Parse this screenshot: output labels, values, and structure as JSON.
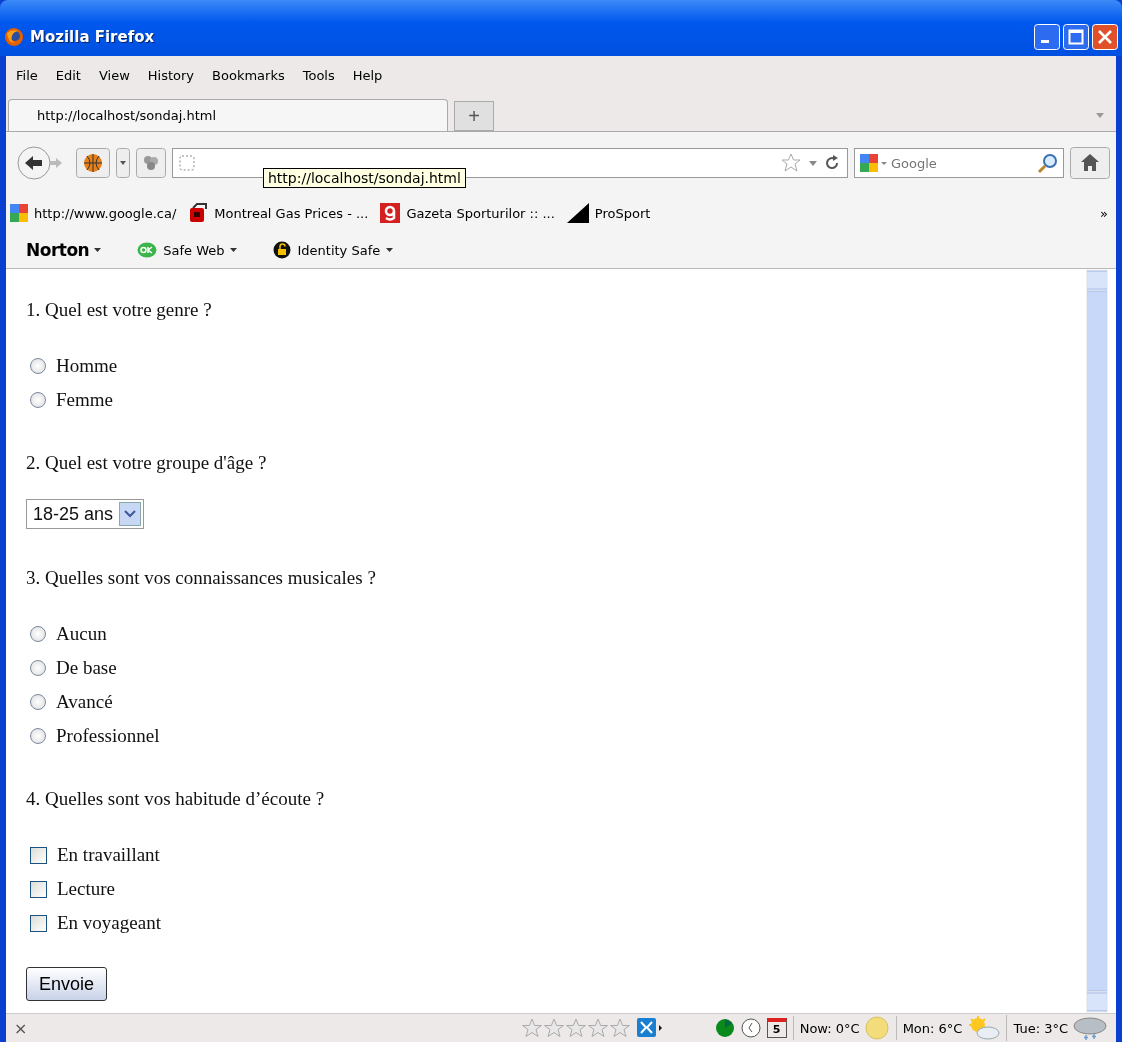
{
  "window": {
    "title": "Mozilla Firefox"
  },
  "menu": [
    "File",
    "Edit",
    "View",
    "History",
    "Bookmarks",
    "Tools",
    "Help"
  ],
  "tabs": [
    {
      "label": "http://localhost/sondaj.html",
      "selected": true
    }
  ],
  "new_tab": "+",
  "tooltip": "http://localhost/sondaj.html",
  "search": {
    "placeholder": "Google"
  },
  "bookmarks": [
    "http://www.google.ca/",
    "Montreal Gas Prices - ...",
    "Gazeta Sporturilor :: ...",
    "ProSport"
  ],
  "bookmarks_more": "»",
  "norton": {
    "brand": "Norton",
    "items": [
      "Safe Web",
      "Identity Safe"
    ]
  },
  "form": {
    "questions": [
      {
        "text": "1. Quel est votre genre ?",
        "kind": "radio",
        "options": [
          {
            "label": "Homme",
            "selected": false
          },
          {
            "label": "Femme",
            "selected": false
          }
        ]
      },
      {
        "text": "2. Quel est votre groupe d'âge ?",
        "kind": "select",
        "value": "18-25 ans"
      },
      {
        "text": "3. Quelles sont vos connaissances musicales ?",
        "kind": "radio",
        "options": [
          {
            "label": "Aucun",
            "selected": false
          },
          {
            "label": "De base",
            "selected": false
          },
          {
            "label": "Avancé",
            "selected": false
          },
          {
            "label": "Professionnel",
            "selected": false
          }
        ]
      },
      {
        "text": "4. Quelles sont vos habitude d’écoute ?",
        "kind": "checkbox",
        "options": [
          {
            "label": "En travaillant",
            "checked": false
          },
          {
            "label": "Lecture",
            "checked": false
          },
          {
            "label": "En voyageant",
            "checked": false
          }
        ]
      }
    ],
    "submit": "Envoie"
  },
  "status_bar": {
    "close": "×",
    "stars": 0,
    "calendar_day": "5",
    "weather": [
      "Now: 0°C",
      "Mon: 6°C",
      "Tue: 3°C"
    ]
  }
}
